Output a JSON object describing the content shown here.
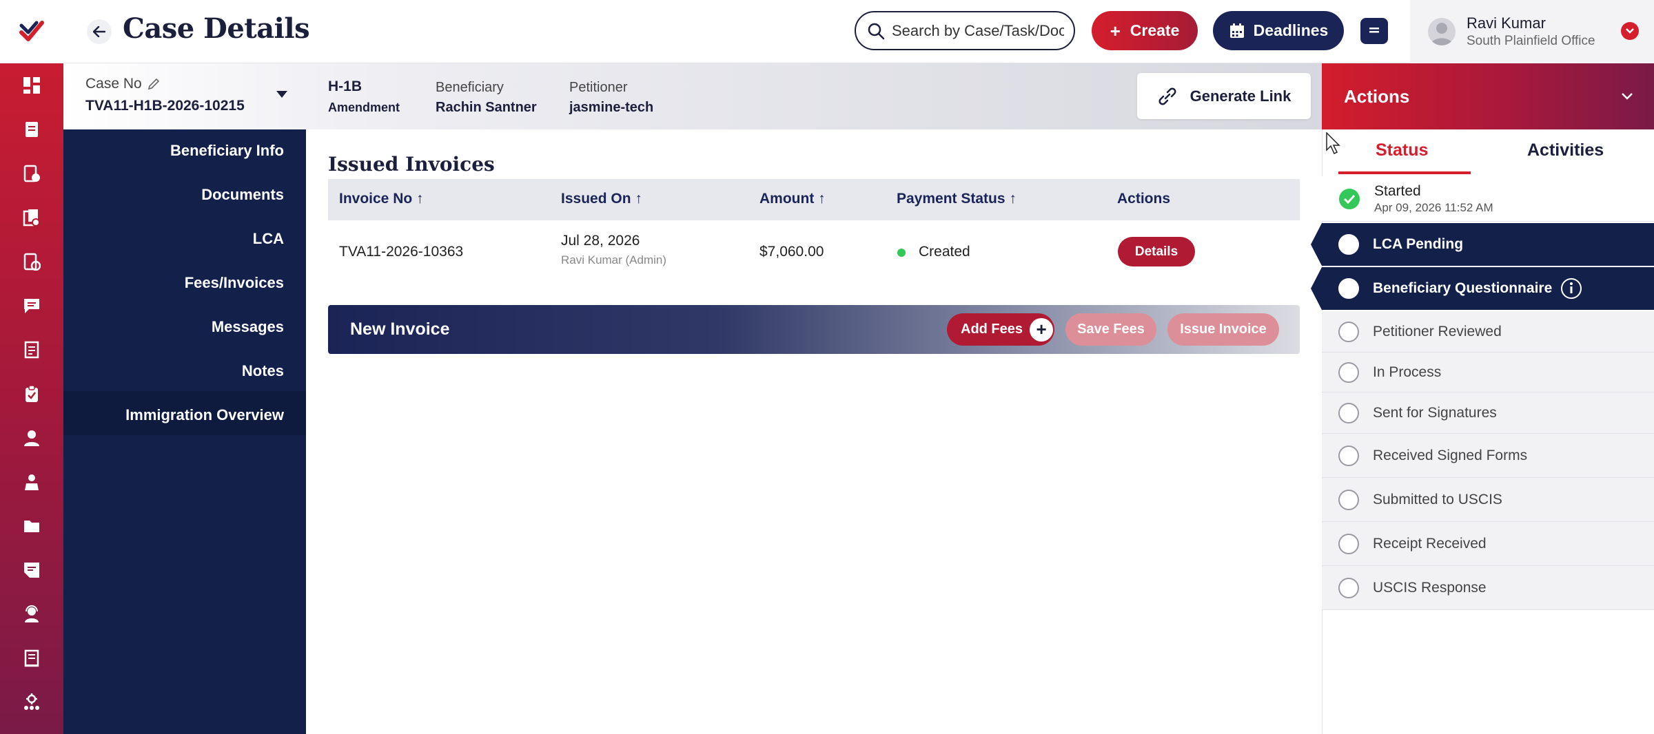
{
  "header": {
    "title": "Case Details",
    "search_placeholder": "Search by Case/Task/Doc",
    "create_label": "Create",
    "deadlines_label": "Deadlines",
    "user_name": "Ravi Kumar",
    "user_office": "South Plainfield Office"
  },
  "case_info": {
    "case_no_label": "Case No",
    "case_no": "TVA11-H1B-2026-10215",
    "visa_type": "H-1B",
    "visa_subtype": "Amendment",
    "beneficiary_label": "Beneficiary",
    "beneficiary": "Rachin Santner",
    "petitioner_label": "Petitioner",
    "petitioner": "jasmine-tech",
    "generate_link_label": "Generate Link"
  },
  "sidenav": {
    "items": [
      {
        "label": "Beneficiary Info"
      },
      {
        "label": "Documents"
      },
      {
        "label": "LCA"
      },
      {
        "label": "Fees/Invoices",
        "active": true
      },
      {
        "label": "Messages"
      },
      {
        "label": "Notes"
      },
      {
        "label": "Immigration Overview"
      }
    ]
  },
  "invoices": {
    "title": "Issued Invoices",
    "columns": [
      "Invoice No",
      "Issued On",
      "Amount",
      "Payment Status",
      "Actions"
    ],
    "rows": [
      {
        "invoice_no": "TVA11-2026-10363",
        "issued_on": "Jul 28, 2026",
        "issued_by": "Ravi Kumar (Admin)",
        "amount": "$7,060.00",
        "payment_status": "Created",
        "status_color": "#34c759",
        "action_label": "Details"
      }
    ]
  },
  "new_invoice": {
    "title": "New Invoice",
    "add_fees_label": "Add Fees",
    "save_fees_label": "Save Fees",
    "issue_invoice_label": "Issue Invoice"
  },
  "actions_panel": {
    "title": "Actions",
    "tabs": [
      {
        "label": "Status",
        "active": true
      },
      {
        "label": "Activities",
        "active": false
      }
    ],
    "statuses": [
      {
        "label": "Started",
        "date": "Apr 09, 2026 11:52 AM",
        "state": "done"
      },
      {
        "label": "LCA Pending",
        "state": "current"
      },
      {
        "label": "Beneficiary Questionnaire",
        "state": "current",
        "info": true
      },
      {
        "label": "Petitioner Reviewed",
        "state": "pending"
      },
      {
        "label": "In Process",
        "state": "pending"
      },
      {
        "label": "Sent for Signatures",
        "state": "pending"
      },
      {
        "label": "Received Signed Forms",
        "state": "pending"
      },
      {
        "label": "Submitted to USCIS",
        "state": "pending"
      },
      {
        "label": "Receipt Received",
        "state": "pending"
      },
      {
        "label": "USCIS Response",
        "state": "pending"
      }
    ]
  },
  "colors": {
    "brand_red": "#d41e2c",
    "navy": "#12204a",
    "success": "#34c759"
  }
}
